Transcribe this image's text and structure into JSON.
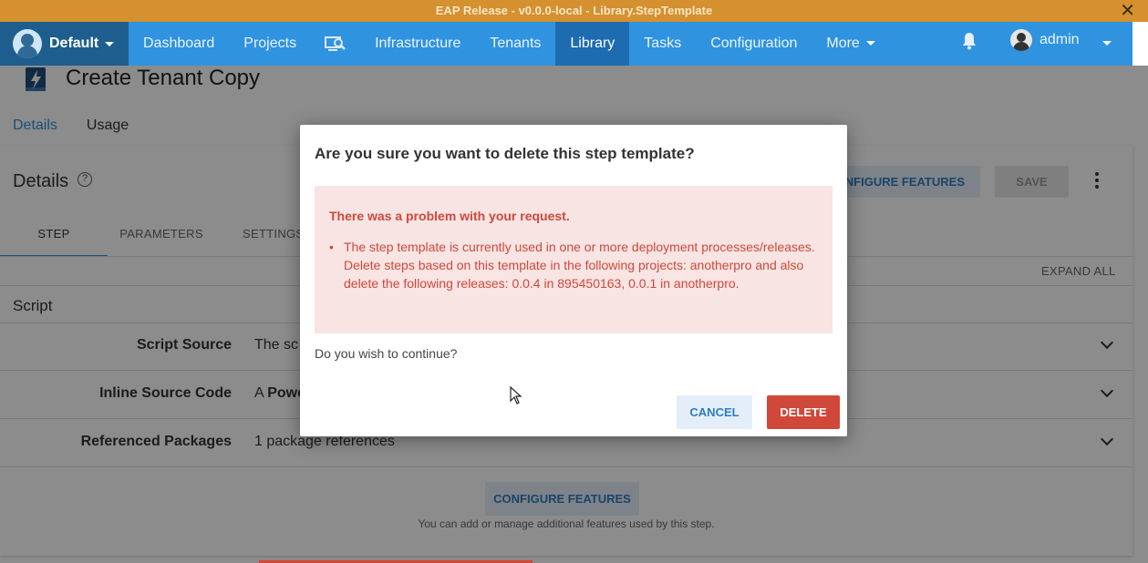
{
  "window": {
    "title": "EAP Release - v0.0.0-local - Library.StepTemplate",
    "close_icon": "close-icon"
  },
  "nav": {
    "space_name": "Default",
    "items": [
      "Dashboard",
      "Projects",
      "Infrastructure",
      "Tenants",
      "Library",
      "Tasks",
      "Configuration",
      "More"
    ],
    "active": "Library",
    "search_icon": "search-computer-icon",
    "bell_icon": "bell-icon",
    "user": "admin"
  },
  "page": {
    "title": "Create Tenant Copy",
    "icon": "step-template-icon",
    "tabs": [
      "Details",
      "Usage"
    ],
    "active_tab": "Details"
  },
  "card": {
    "title": "Details",
    "configure_features_label": "CONFIGURE FEATURES",
    "save_label": "SAVE",
    "inner_tabs": [
      "STEP",
      "PARAMETERS",
      "SETTINGS"
    ],
    "expand_all": "EXPAND ALL",
    "section": "Script",
    "rows": [
      {
        "label": "Script Source",
        "value": "The sc"
      },
      {
        "label": "Inline Source Code",
        "value_prefix": "A ",
        "value_bold": "Powe"
      },
      {
        "label": "Referenced Packages",
        "value": "1 package references"
      }
    ],
    "bottom_configure": "CONFIGURE FEATURES",
    "hint": "You can add or manage additional features used by this step."
  },
  "dialog": {
    "title": "Are you sure you want to delete this step template?",
    "error_heading": "There was a problem with your request.",
    "error_message": "The step template is currently used in one or more deployment processes/releases. Delete steps based on this template in the following projects: anotherpro and also delete the following releases: 0.0.4 in 895450163, 0.0.1 in anotherpro.",
    "question": "Do you wish to continue?",
    "cancel": "CANCEL",
    "delete": "DELETE"
  },
  "colors": {
    "titlebar": "#d5902f",
    "nav": "#2f93e0",
    "nav_active": "#1d6cb0",
    "danger": "#d0483a",
    "error_bg": "#f8e4e3"
  }
}
